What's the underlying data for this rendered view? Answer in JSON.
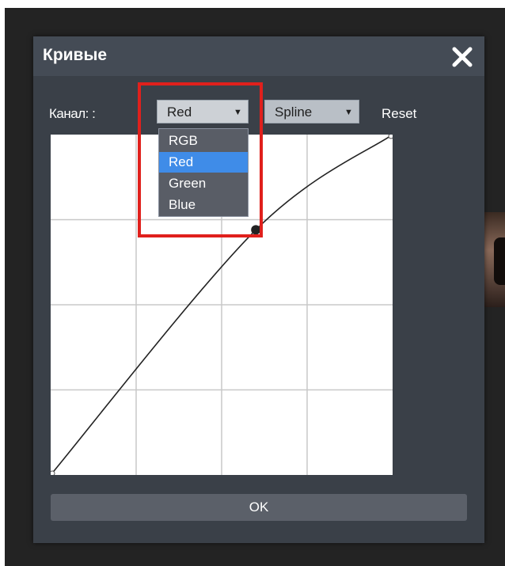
{
  "dialog": {
    "title": "Кривые",
    "close_icon": "close-icon",
    "channel_label": "Канал: :",
    "channel_select": {
      "value": "Red",
      "arrow_icon": "triangle-down-icon"
    },
    "mode_select": {
      "value": "Spline",
      "arrow_icon": "triangle-down-icon"
    },
    "reset_label": "Reset",
    "channel_options": [
      "RGB",
      "Red",
      "Green",
      "Blue"
    ],
    "selected_option": "Red",
    "ok_label": "OK"
  },
  "curve": {
    "grid_divisions": 4,
    "points": [
      [
        0,
        0
      ],
      [
        0.6,
        0.72
      ],
      [
        1,
        1
      ]
    ],
    "control_point": [
      0.6,
      0.72
    ]
  },
  "colors": {
    "highlight": "#e0201c",
    "selected_option": "#3f8ce8",
    "dialog_bg": "#3a4048",
    "titlebar_bg": "#444b55"
  }
}
